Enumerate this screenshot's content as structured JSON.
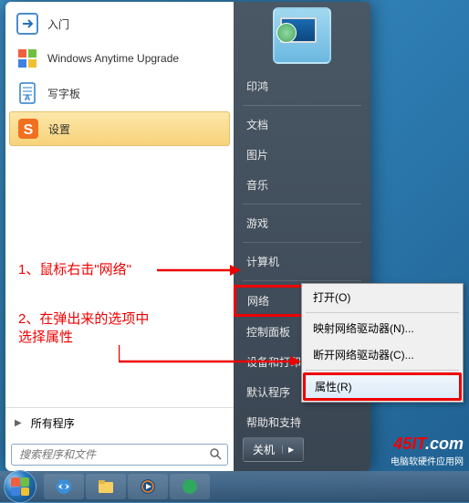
{
  "programs": [
    {
      "label": "入门",
      "icon": "intro"
    },
    {
      "label": "Windows Anytime Upgrade",
      "icon": "upgrade"
    },
    {
      "label": "写字板",
      "icon": "wordpad"
    },
    {
      "label": "设置",
      "icon": "settings",
      "highlighted": true
    }
  ],
  "all_programs_label": "所有程序",
  "search_placeholder": "搜索程序和文件",
  "right_items": [
    {
      "label": "印鸿",
      "sep_after": true
    },
    {
      "label": "文档"
    },
    {
      "label": "图片"
    },
    {
      "label": "音乐",
      "sep_after": true
    },
    {
      "label": "游戏",
      "sep_after": true
    },
    {
      "label": "计算机",
      "sep_after": true
    },
    {
      "label": "网络",
      "boxed": true
    },
    {
      "label": "控制面板"
    },
    {
      "label": "设备和打印机"
    },
    {
      "label": "默认程序"
    },
    {
      "label": "帮助和支持"
    }
  ],
  "shutdown_label": "关机",
  "context_menu": [
    {
      "label": "打开(O)",
      "sep_after": true
    },
    {
      "label": "映射网络驱动器(N)..."
    },
    {
      "label": "断开网络驱动器(C)...",
      "sep_after": true
    },
    {
      "label": "属性(R)",
      "selected": true,
      "boxed": true
    }
  ],
  "annotations": {
    "a1": "1、鼠标右击\"网络\"",
    "a2_line1": "2、在弹出来的选项中",
    "a2_line2": "选择属性"
  },
  "watermark": {
    "logo_part1": "45IT",
    "logo_part2": ".com",
    "subtitle": "电脑软硬件应用网"
  }
}
